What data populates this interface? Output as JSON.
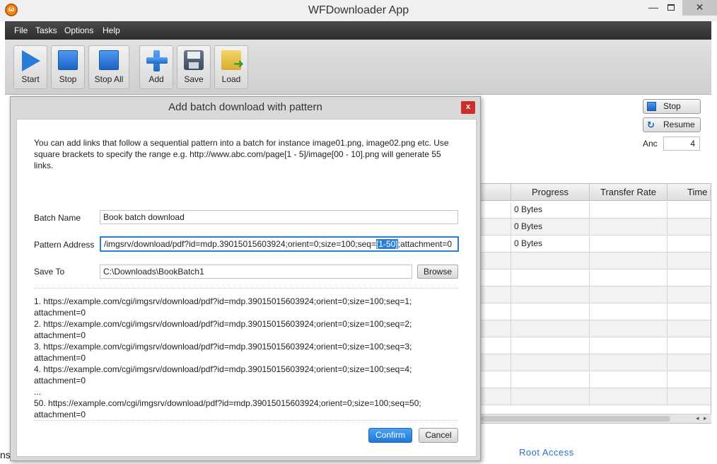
{
  "window": {
    "title": "WFDownloader App",
    "icon_letter": "ω",
    "min_glyph": "—",
    "close_glyph": "✕"
  },
  "menu": [
    "File",
    "Tasks",
    "Options",
    "Help"
  ],
  "toolbar": {
    "start": "Start",
    "stop": "Stop",
    "stop_all": "Stop All",
    "add": "Add",
    "save": "Save",
    "load": "Load"
  },
  "side_panel": {
    "stop": "Stop",
    "resume": "Resume",
    "anc_label": "Anc",
    "anc_value": "4"
  },
  "table": {
    "headers": [
      "Progress",
      "Transfer Rate",
      "Time l"
    ],
    "rows": [
      {
        "progress": "0 Bytes"
      },
      {
        "progress": "0 Bytes"
      },
      {
        "progress": "0 Bytes"
      }
    ]
  },
  "footer": {
    "root_access": "Root Access",
    "left_fragment": "ns"
  },
  "dialog": {
    "title": "Add batch download with pattern",
    "close": "x",
    "description": "You can add links that follow a sequential pattern into a batch for instance image01.png, image02.png etc. Use square brackets to specify the range e.g. http://www.abc.com/page[1 - 5]/image[00 - 10].png will generate 55 links.",
    "batch_name_label": "Batch Name",
    "batch_name_value": "Book batch download",
    "pattern_label": "Pattern Address",
    "pattern_before": "/imgsrv/download/pdf?id=mdp.39015015603924;orient=0;size=100;seq=",
    "pattern_selected": "[1-50]",
    "pattern_after": ";attachment=0",
    "save_to_label": "Save To",
    "save_to_value": "C:\\Downloads\\BookBatch1",
    "browse": "Browse",
    "preview": [
      "1. https://example.com/cgi/imgsrv/download/pdf?id=mdp.39015015603924;orient=0;size=100;seq=1;",
      "attachment=0",
      "2. https://example.com/cgi/imgsrv/download/pdf?id=mdp.39015015603924;orient=0;size=100;seq=2;",
      "attachment=0",
      "3. https://example.com/cgi/imgsrv/download/pdf?id=mdp.39015015603924;orient=0;size=100;seq=3;",
      "attachment=0",
      "4. https://example.com/cgi/imgsrv/download/pdf?id=mdp.39015015603924;orient=0;size=100;seq=4;",
      "attachment=0",
      "...",
      "50. https://example.com/cgi/imgsrv/download/pdf?id=mdp.39015015603924;orient=0;size=100;seq=50;",
      "attachment=0"
    ],
    "confirm": "Confirm",
    "cancel": "Cancel"
  }
}
